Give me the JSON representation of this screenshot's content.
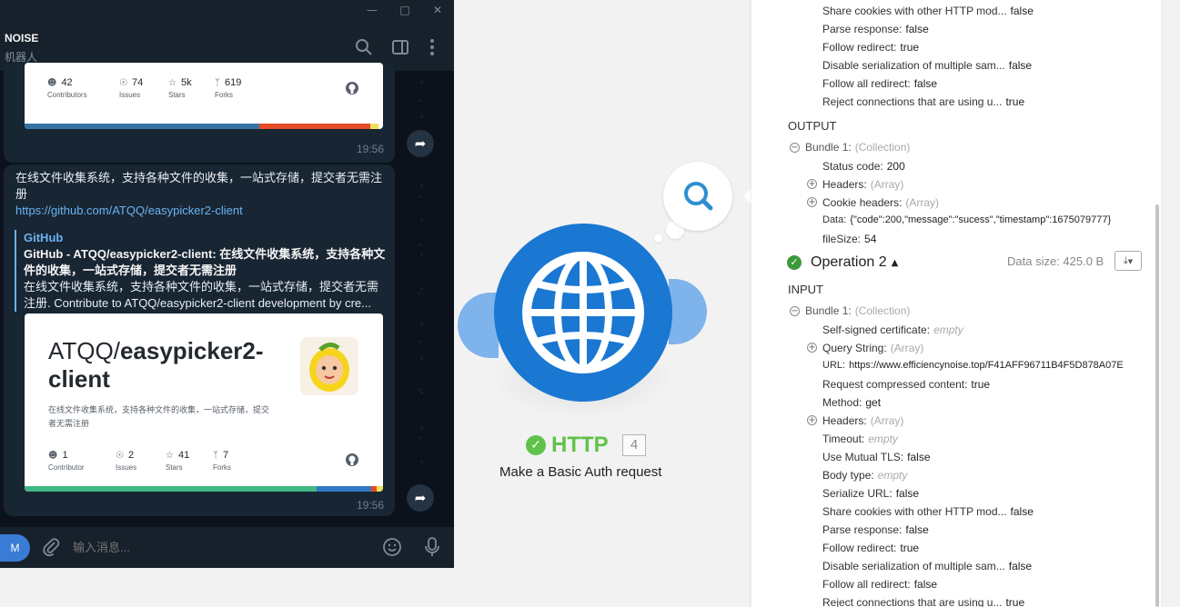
{
  "telegram": {
    "chat_name": "NOISE",
    "chat_subtitle": "机器人",
    "card1": {
      "stats": [
        {
          "icon": "people-icon",
          "value": "42",
          "label": "Contributors"
        },
        {
          "icon": "issues-icon",
          "value": "74",
          "label": "Issues"
        },
        {
          "icon": "star-icon",
          "value": "5k",
          "label": "Stars"
        },
        {
          "icon": "fork-icon",
          "value": "619",
          "label": "Forks"
        }
      ],
      "time": "19:56"
    },
    "message2": {
      "text": "在线文件收集系统，支持各种文件的收集，一站式存储，提交者无需注册",
      "link": "https://github.com/ATQQ/easypicker2-client",
      "preview_site": "GitHub",
      "preview_title": "GitHub - ATQQ/easypicker2-client: 在线文件收集系统，支持各种文件的收集，一站式存储，提交者无需注册",
      "preview_desc_line1": "在线文件收集系统，支持各种文件的收集，一站式存储，提交者无需",
      "preview_desc_line2": "注册. Contribute to ATQQ/easypicker2-client development by cre...",
      "card_owner": "ATQQ/",
      "card_repo_line1": "easypicker2-",
      "card_repo_line2": "client",
      "card_desc": "在线文件收集系统，支持各种文件的收集，一站式存储，提交者无需注册",
      "stats": [
        {
          "icon": "people-icon",
          "value": "1",
          "label": "Contributor"
        },
        {
          "icon": "issues-icon",
          "value": "2",
          "label": "Issues"
        },
        {
          "icon": "star-icon",
          "value": "41",
          "label": "Stars"
        },
        {
          "icon": "fork-icon",
          "value": "7",
          "label": "Forks"
        }
      ],
      "time": "19:56"
    },
    "input": {
      "avatar": "M",
      "placeholder": "输入消息..."
    }
  },
  "module": {
    "title": "HTTP",
    "number": "4",
    "subtitle": "Make a Basic Auth request",
    "colors": {
      "node": "#1a77d2",
      "success": "#60c24a"
    }
  },
  "inspector": {
    "top_rows": [
      {
        "k": "Share cookies with other HTTP mod...",
        "v": "false"
      },
      {
        "k": "Parse response:",
        "v": "false"
      },
      {
        "k": "Follow redirect:",
        "v": "true"
      },
      {
        "k": "Disable serialization of multiple sam...",
        "v": "false"
      },
      {
        "k": "Follow all redirect:",
        "v": "false"
      },
      {
        "k": "Reject connections that are using u...",
        "v": "true"
      }
    ],
    "output_label": "OUTPUT",
    "output_bundle": "Bundle 1:",
    "output_bundle_type": "(Collection)",
    "output_rows": [
      {
        "k": "Status code:",
        "v": "200"
      },
      {
        "k": "Headers:",
        "v": "(Array)",
        "expand": true
      },
      {
        "k": "Cookie headers:",
        "v": "(Array)",
        "expand": true
      },
      {
        "k": "Data:",
        "v": "{\"code\":200,\"message\":\"sucess\",\"timestamp\":1675079777}"
      },
      {
        "k": "fileSize:",
        "v": "54"
      }
    ],
    "operation_title": "Operation 2",
    "data_size": "Data size: 425.0 B",
    "input_label": "INPUT",
    "input_bundle": "Bundle 1:",
    "input_bundle_type": "(Collection)",
    "input_rows": [
      {
        "k": "Self-signed certificate:",
        "v": "empty",
        "muted": true
      },
      {
        "k": "Query String:",
        "v": "(Array)",
        "expand": true
      },
      {
        "k": "URL:",
        "v": "https://www.efficiencynoise.top/F41AFF96711B4F5D878A07E"
      },
      {
        "k": "Request compressed content:",
        "v": "true"
      },
      {
        "k": "Method:",
        "v": "get"
      },
      {
        "k": "Headers:",
        "v": "(Array)",
        "expand": true
      },
      {
        "k": "Timeout:",
        "v": "empty",
        "muted": true
      },
      {
        "k": "Use Mutual TLS:",
        "v": "false"
      },
      {
        "k": "Body type:",
        "v": "empty",
        "muted": true
      },
      {
        "k": "Serialize URL:",
        "v": "false"
      },
      {
        "k": "Share cookies with other HTTP mod...",
        "v": "false"
      },
      {
        "k": "Parse response:",
        "v": "false"
      },
      {
        "k": "Follow redirect:",
        "v": "true"
      },
      {
        "k": "Disable serialization of multiple sam...",
        "v": "false"
      },
      {
        "k": "Follow all redirect:",
        "v": "false"
      },
      {
        "k": "Reject connections that are using u...",
        "v": "true"
      }
    ]
  }
}
